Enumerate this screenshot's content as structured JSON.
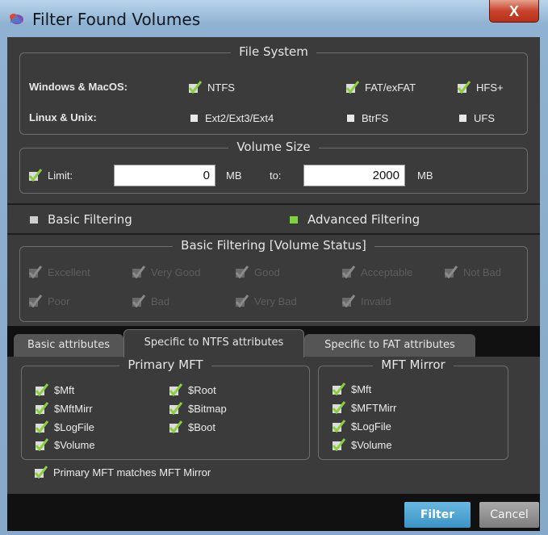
{
  "window": {
    "title": "Filter Found Volumes",
    "close_glyph": "X"
  },
  "file_system": {
    "title": "File System",
    "rows": [
      {
        "label": "Windows & MacOS:",
        "options": [
          {
            "label": "NTFS",
            "checked": true
          },
          {
            "label": "FAT/exFAT",
            "checked": true
          },
          {
            "label": "HFS+",
            "checked": true
          }
        ]
      },
      {
        "label": "Linux & Unix:",
        "options": [
          {
            "label": "Ext2/Ext3/Ext4",
            "checked": false
          },
          {
            "label": "BtrFS",
            "checked": false
          },
          {
            "label": "UFS",
            "checked": false
          }
        ]
      }
    ]
  },
  "volume_size": {
    "title": "Volume Size",
    "limit_label": "Limit:",
    "limit_checked": true,
    "from_value": "0",
    "from_unit": "MB",
    "to_label": "to:",
    "to_value": "2000",
    "to_unit": "MB"
  },
  "filtering_mode": {
    "basic_label": "Basic Filtering",
    "advanced_label": "Advanced Filtering",
    "selected": "advanced"
  },
  "basic_filtering": {
    "title": "Basic Filtering [Volume Status]",
    "row1": [
      "Excellent",
      "Very Good",
      "Good",
      "Acceptable",
      "Not Bad"
    ],
    "row2": [
      "Poor",
      "Bad",
      "Very Bad",
      "Invalid"
    ]
  },
  "tabs": [
    {
      "label": "Basic attributes",
      "active": false
    },
    {
      "label": "Specific to NTFS attributes",
      "active": true
    },
    {
      "label": "Specific to FAT attributes",
      "active": false
    }
  ],
  "primary_mft": {
    "title": "Primary MFT",
    "col1": [
      "$Mft",
      "$MftMirr",
      "$LogFile",
      "$Volume"
    ],
    "col2": [
      "$Root",
      "$Bitmap",
      "$Boot"
    ]
  },
  "mft_mirror": {
    "title": "MFT Mirror",
    "items": [
      "$Mft",
      "$MFTMirr",
      "$LogFile",
      "$Volume"
    ]
  },
  "match_option": {
    "label": "Primary MFT matches MFT Mirror",
    "checked": true
  },
  "buttons": {
    "filter": "Filter",
    "cancel": "Cancel"
  },
  "colors": {
    "check": "#8bcf3c",
    "accent": "#3a94c6",
    "panel": "#3b3b3b",
    "close": "#c8432c"
  }
}
